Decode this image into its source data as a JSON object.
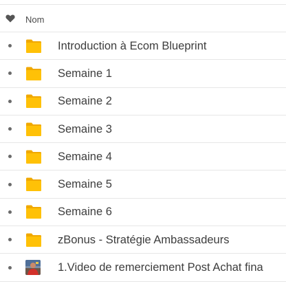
{
  "header": {
    "name_column_label": "Nom",
    "favorite_icon": "heart-icon"
  },
  "colors": {
    "folder": "#ffc107",
    "folder_shade": "#f0a800",
    "text": "#3d3d3d",
    "divider": "#e6e6e6",
    "bullet": "#6b6b6b"
  },
  "files": [
    {
      "type": "folder",
      "icon": "folder-icon",
      "label": "Introduction à Ecom Blueprint"
    },
    {
      "type": "folder",
      "icon": "folder-icon",
      "label": "Semaine 1"
    },
    {
      "type": "folder",
      "icon": "folder-icon",
      "label": "Semaine 2"
    },
    {
      "type": "folder",
      "icon": "folder-icon",
      "label": "Semaine 3"
    },
    {
      "type": "folder",
      "icon": "folder-icon",
      "label": "Semaine 4"
    },
    {
      "type": "folder",
      "icon": "folder-icon",
      "label": "Semaine 5"
    },
    {
      "type": "folder",
      "icon": "folder-icon",
      "label": "Semaine 6"
    },
    {
      "type": "folder",
      "icon": "folder-icon",
      "label": "zBonus - Stratégie Ambassadeurs"
    },
    {
      "type": "video",
      "icon": "video-thumbnail-icon",
      "label": "1.Video de remerciement Post Achat fina"
    }
  ]
}
